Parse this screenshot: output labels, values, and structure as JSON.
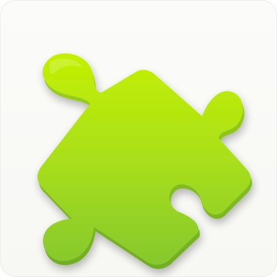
{
  "icon": {
    "depicts": "puzzle-piece",
    "colors": {
      "background": "#f8f8f5",
      "piece_top": "#c4f000",
      "piece_mid": "#a9df1b",
      "piece_bottom": "#86c82e",
      "piece_edge": "#6fae24",
      "shadow": "#5a7a1e"
    }
  }
}
